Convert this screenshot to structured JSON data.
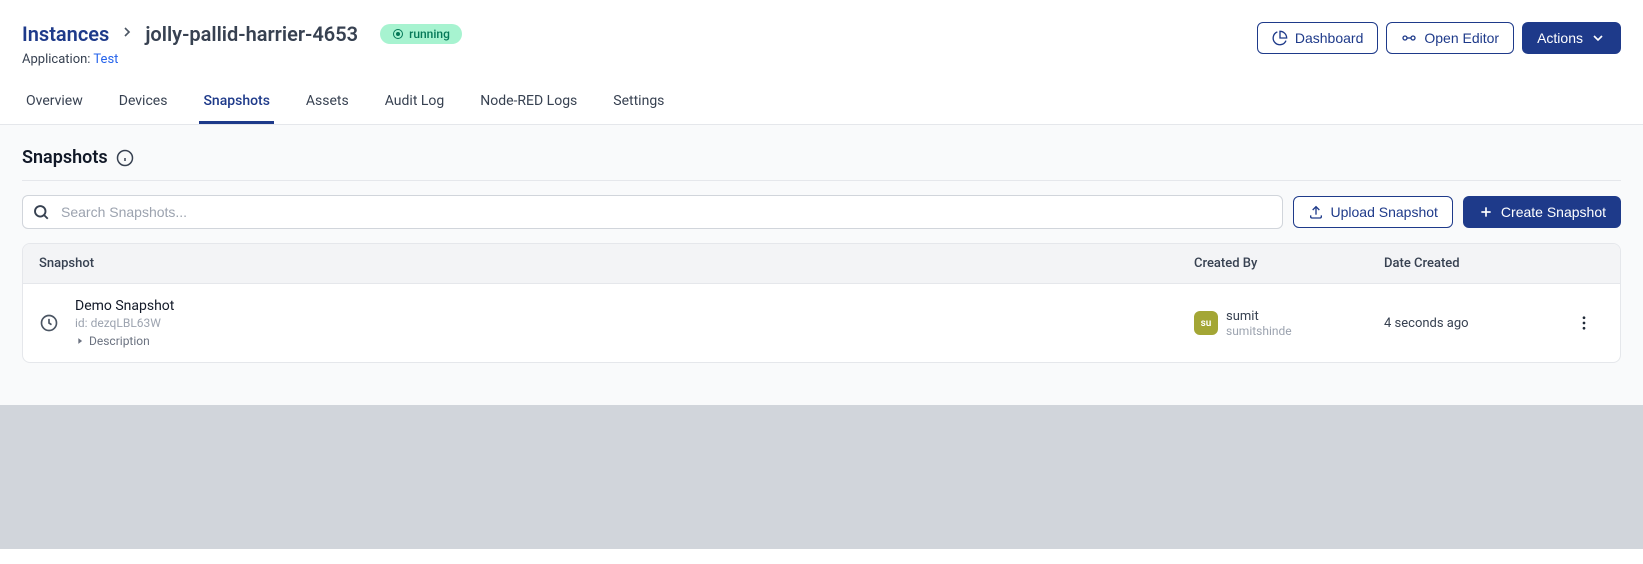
{
  "header": {
    "breadcrumb_root": "Instances",
    "instance_name": "jolly-pallid-harrier-4653",
    "status": "running",
    "application_label": "Application:",
    "application_name": "Test"
  },
  "actions": {
    "dashboard": "Dashboard",
    "open_editor": "Open Editor",
    "actions": "Actions"
  },
  "tabs": [
    "Overview",
    "Devices",
    "Snapshots",
    "Assets",
    "Audit Log",
    "Node-RED Logs",
    "Settings"
  ],
  "active_tab": "Snapshots",
  "section": {
    "title": "Snapshots"
  },
  "search": {
    "placeholder": "Search Snapshots..."
  },
  "buttons": {
    "upload": "Upload Snapshot",
    "create": "Create Snapshot"
  },
  "table": {
    "columns": {
      "snapshot": "Snapshot",
      "created_by": "Created By",
      "date_created": "Date Created"
    },
    "rows": [
      {
        "name": "Demo Snapshot",
        "id_label": "id: dezqLBL63W",
        "description_toggle": "Description",
        "user_avatar": "su",
        "user_name": "sumit",
        "user_handle": "sumitshinde",
        "date": "4 seconds ago"
      }
    ]
  }
}
